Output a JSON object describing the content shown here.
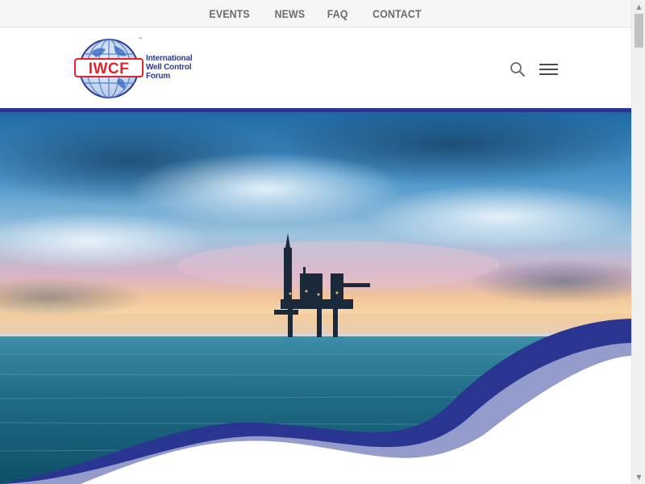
{
  "topnav": {
    "items": [
      "EVENTS",
      "NEWS",
      "FAQ",
      "CONTACT"
    ]
  },
  "header": {
    "logo": {
      "abbr": "IWCF",
      "trademark": "™",
      "name_lines": [
        "International",
        "Well Control",
        "Forum"
      ]
    },
    "search_icon": "search-icon",
    "menu_icon": "hamburger-menu-icon"
  },
  "hero": {
    "image": "offshore-oil-rig-at-sunset"
  },
  "colors": {
    "brand_blue": "#2a3591",
    "logo_red": "#e3222f",
    "topbar_bg": "#f6f6f6",
    "nav_text": "#6b6b6b"
  },
  "scrollbar": {
    "up": "▲",
    "down": "▼"
  }
}
